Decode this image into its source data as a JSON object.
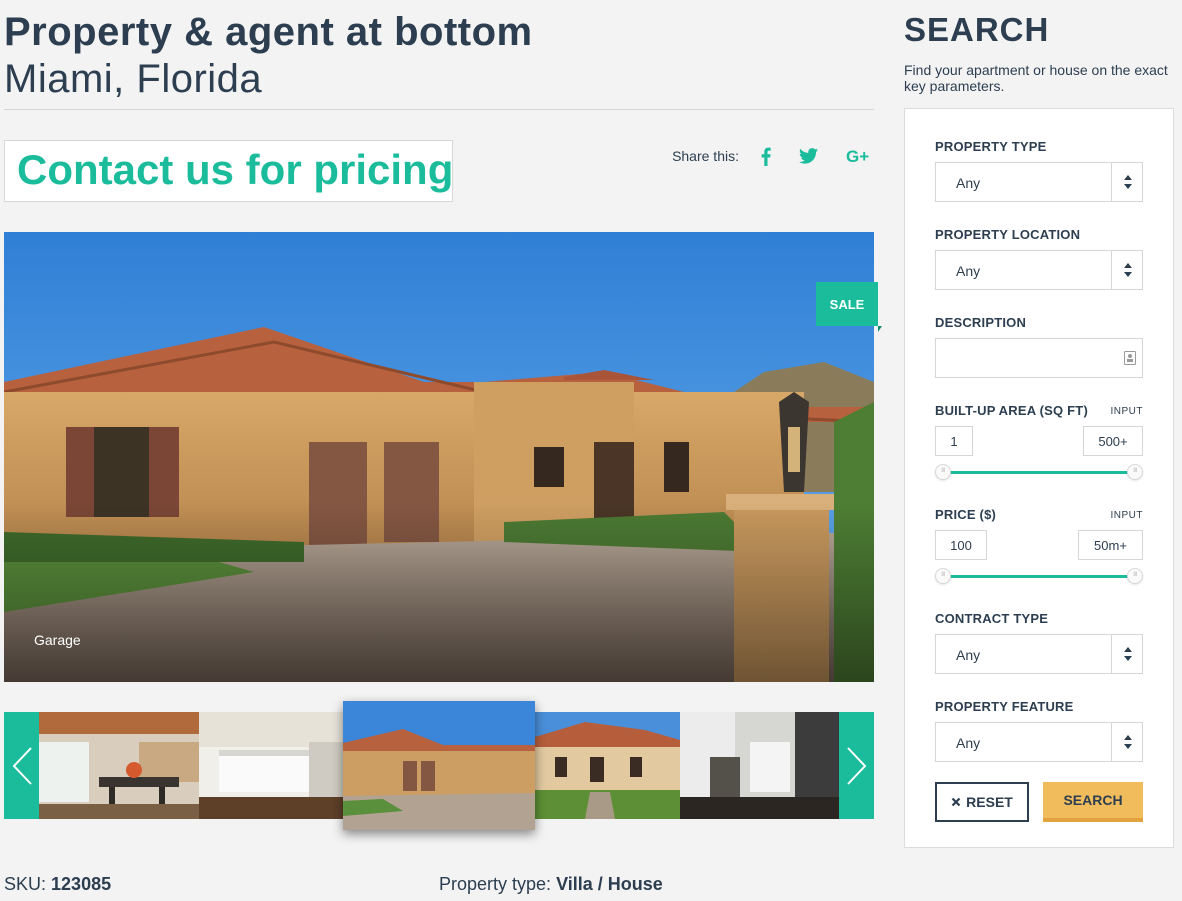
{
  "listing": {
    "title": "Property & agent at bottom",
    "location": "Miami, Florida",
    "price_text": "Contact us for pricing",
    "share_label": "Share this:",
    "share_icons": [
      "facebook-icon",
      "twitter-icon",
      "google-plus-icon"
    ],
    "badge": "SALE",
    "image_caption": "Garage",
    "sku_label": "SKU:",
    "sku_value": "123085",
    "property_type_label": "Property type:",
    "property_type_value": "Villa / House"
  },
  "gallery": {
    "thumbnails": [
      "dining-room",
      "kitchen",
      "villa-exterior",
      "mediterranean-house",
      "modern-kitchen"
    ],
    "active_index": 2
  },
  "search": {
    "title": "SEARCH",
    "description": "Find your apartment or house on the exact key parameters.",
    "property_type": {
      "label": "PROPERTY TYPE",
      "value": "Any"
    },
    "property_location": {
      "label": "PROPERTY LOCATION",
      "value": "Any"
    },
    "description_field": {
      "label": "DESCRIPTION",
      "value": ""
    },
    "area": {
      "label": "BUILT-UP AREA (SQ FT)",
      "input_link": "INPUT",
      "min": "1",
      "max": "500+"
    },
    "price": {
      "label": "PRICE ($)",
      "input_link": "INPUT",
      "min": "100",
      "max": "50m+"
    },
    "contract_type": {
      "label": "CONTRACT TYPE",
      "value": "Any"
    },
    "property_feature": {
      "label": "PROPERTY FEATURE",
      "value": "Any"
    },
    "reset_label": "RESET",
    "reset_icon": "close-icon",
    "search_label": "SEARCH"
  },
  "colors": {
    "accent": "#1abc9c",
    "text": "#2c3e50",
    "search_button": "#f1bc5c"
  }
}
